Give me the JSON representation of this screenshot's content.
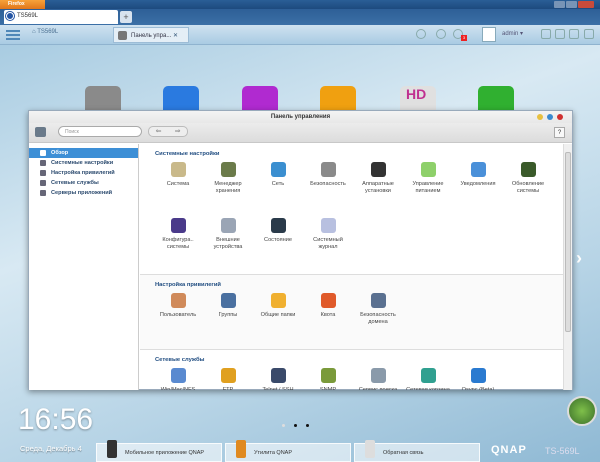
{
  "browser": {
    "menu_label": "Firefox",
    "tab_title": "TS569L",
    "new_tab": "+"
  },
  "toolbar": {
    "home_label": "TS569L",
    "app_tab": "Панель упра...",
    "app_tab_close": "✕",
    "notification_count": "3",
    "user": "admin ▾"
  },
  "window": {
    "title": "Панель управления",
    "search_placeholder": "Поиск",
    "back": "⇐",
    "forward": "⇒",
    "help": "?"
  },
  "sidebar": {
    "items": [
      {
        "label": "Обзор",
        "selected": true
      },
      {
        "label": "Системные настройки"
      },
      {
        "label": "Настройка привилегий"
      },
      {
        "label": "Сетевые службы"
      },
      {
        "label": "Серверы приложений"
      }
    ]
  },
  "sections": [
    {
      "title": "Системные настройки",
      "items": [
        {
          "label": "Система",
          "color": "#c9b98a"
        },
        {
          "label": "Менеджер хранения",
          "color": "#6b7b4a"
        },
        {
          "label": "Сеть",
          "color": "#3b8fd0"
        },
        {
          "label": "Безопасность",
          "color": "#8a8a8a"
        },
        {
          "label": "Аппаратные установки",
          "color": "#333333"
        },
        {
          "label": "Управление питанием",
          "color": "#8ed06a"
        },
        {
          "label": "Уведомления",
          "color": "#4a90d9"
        },
        {
          "label": "Обновление системы",
          "color": "#3a5a2a"
        },
        {
          "label": "Конфигура.. системы",
          "color": "#4a3a8a"
        },
        {
          "label": "Внешние устройства",
          "color": "#9aa5b5"
        },
        {
          "label": "Состояние",
          "color": "#2a3a4a"
        },
        {
          "label": "Системный журнал",
          "color": "#b8c0e0"
        }
      ]
    },
    {
      "title": "Настройка привилегий",
      "items": [
        {
          "label": "Пользователь",
          "color": "#d08a5a"
        },
        {
          "label": "Группы",
          "color": "#4a70a0"
        },
        {
          "label": "Общие папки",
          "color": "#f0b030"
        },
        {
          "label": "Квота",
          "color": "#e05a2a"
        },
        {
          "label": "Безопасность домена",
          "color": "#5a7090"
        }
      ]
    },
    {
      "title": "Сетевые службы",
      "items": [
        {
          "label": "Win/Mac/NFS",
          "color": "#5a8ad0"
        },
        {
          "label": "FTP",
          "color": "#e0a020"
        },
        {
          "label": "Telnet / SSH",
          "color": "#3a4a6a"
        },
        {
          "label": "SNMP",
          "color": "#7a9a3a"
        },
        {
          "label": "Сервис поиска",
          "color": "#8a9aaa"
        },
        {
          "label": "Сетевая корзина",
          "color": "#30a090"
        },
        {
          "label": "Qsync (Beta)",
          "color": "#2a7ad0"
        }
      ]
    }
  ],
  "desktop": {
    "app_colors": [
      "#8a8a8a",
      "#2a7ae0",
      "#b02ad0",
      "#f0a010",
      "#e0e0e0",
      "#30b030"
    ],
    "hd_label": "HD"
  },
  "clock": {
    "time": "16:56",
    "date": "Среда, Декабрь 4"
  },
  "bottom_bar": [
    {
      "label": "Мобильное приложение QNAP"
    },
    {
      "label": "Утилита QNAP"
    },
    {
      "label": "Обратная связь"
    }
  ],
  "brand": {
    "logo": "QNAP",
    "model": "TS-569L"
  }
}
